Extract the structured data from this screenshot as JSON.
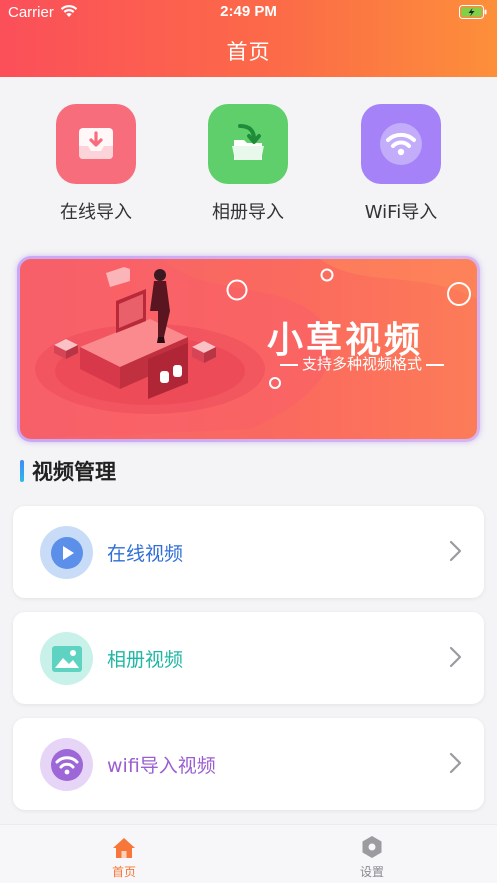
{
  "status_bar": {
    "carrier": "Carrier",
    "time": "2:49 PM"
  },
  "header": {
    "title": "首页"
  },
  "actions": [
    {
      "label": "在线导入",
      "icon": "download-tray-icon",
      "color": "#f86d7c"
    },
    {
      "label": "相册导入",
      "icon": "folder-import-icon",
      "color": "#5ecf6a"
    },
    {
      "label": "WiFi导入",
      "icon": "wifi-icon",
      "color": "#a582f7"
    }
  ],
  "banner": {
    "title": "小草视频",
    "subtitle": "支持多种视频格式"
  },
  "section": {
    "title": "视频管理"
  },
  "cards": [
    {
      "label": "在线视频",
      "icon": "play-icon",
      "color": "#2f6fd6"
    },
    {
      "label": "相册视频",
      "icon": "image-icon",
      "color": "#1fb7a4"
    },
    {
      "label": "wifi导入视频",
      "icon": "wifi-icon",
      "color": "#9a5fd0"
    }
  ],
  "tabbar": {
    "home_label": "首页",
    "settings_label": "设置",
    "active_color": "#f7773a"
  }
}
